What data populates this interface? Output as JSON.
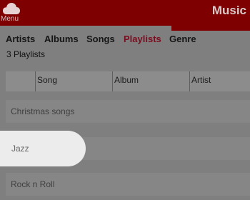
{
  "header": {
    "menu_label": "Menu",
    "menu_icon": "cloud-icon",
    "title": "Music",
    "brand_color": "#7f0000"
  },
  "tabs": [
    {
      "label": "Artists",
      "active": false
    },
    {
      "label": "Albums",
      "active": false
    },
    {
      "label": "Songs",
      "active": false
    },
    {
      "label": "Playlists",
      "active": true
    },
    {
      "label": "Genre",
      "active": false
    }
  ],
  "playlists": {
    "count_text": "3 Playlists",
    "columns": [
      "",
      "Song",
      "Album",
      "Artist"
    ],
    "items": [
      {
        "name": "Christmas songs"
      },
      {
        "name": "Jazz",
        "highlighted": true
      },
      {
        "name": "Rock n Roll"
      }
    ]
  }
}
